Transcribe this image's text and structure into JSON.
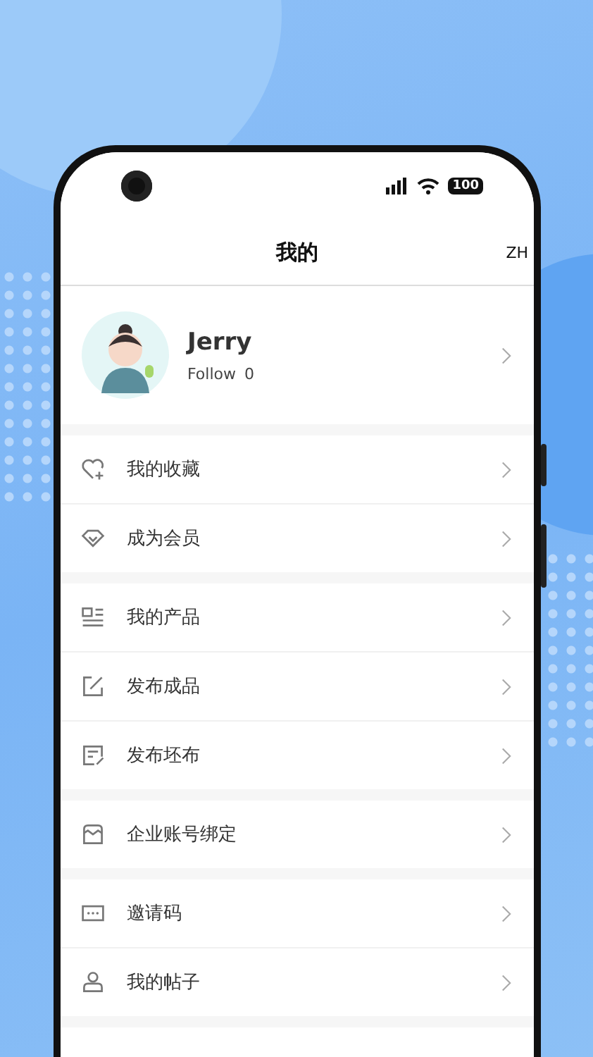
{
  "status_bar": {
    "battery": "100"
  },
  "header": {
    "title": "我的",
    "language": "ZH"
  },
  "profile": {
    "name": "Jerry",
    "follow_label": "Follow",
    "follow_count": "0"
  },
  "menu_groups": [
    {
      "items": [
        {
          "label": "我的收藏"
        },
        {
          "label": "成为会员"
        }
      ]
    },
    {
      "items": [
        {
          "label": "我的产品"
        },
        {
          "label": "发布成品"
        },
        {
          "label": "发布坯布"
        }
      ]
    },
    {
      "items": [
        {
          "label": "企业账号绑定"
        }
      ]
    },
    {
      "items": [
        {
          "label": "邀请码"
        },
        {
          "label": "我的帖子"
        }
      ]
    }
  ]
}
